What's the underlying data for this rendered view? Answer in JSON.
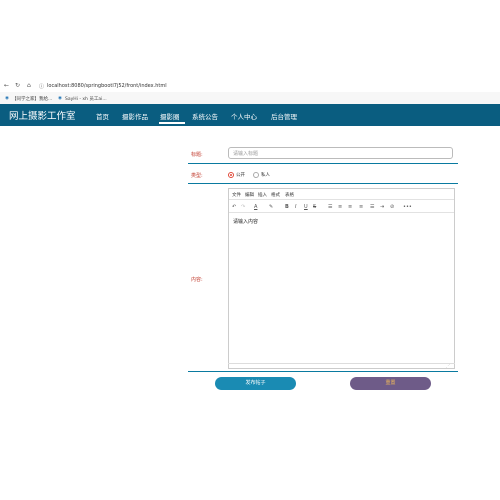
{
  "browser": {
    "url": "localhost:8080/springbootl7j52/front/index.html",
    "bookmarks": [
      "【同学之家】我给...",
      "SayHi - xh 员工ai..."
    ]
  },
  "site": {
    "brand": "网上摄影工作室",
    "nav": [
      "首页",
      "摄影作品",
      "摄影圈",
      "系统公告",
      "个人中心",
      "后台管理"
    ],
    "active_index": 2
  },
  "form": {
    "title_label": "标题:",
    "title_placeholder": "请输入标题",
    "type_label": "类型:",
    "type_options": [
      "公开",
      "私人"
    ],
    "type_selected": "公开",
    "content_label": "内容:",
    "editor_menu": [
      "文件",
      "编辑",
      "插入",
      "格式",
      "表格"
    ],
    "editor_placeholder": "请输入内容",
    "submit_label": "发布帖子",
    "reset_label": "重置"
  },
  "colors": {
    "nav_bg": "#0a5d80",
    "label": "#c0392b",
    "submit_bg": "#1a8bb3",
    "reset_bg": "#6e5b88",
    "reset_text": "#f0b95a"
  }
}
